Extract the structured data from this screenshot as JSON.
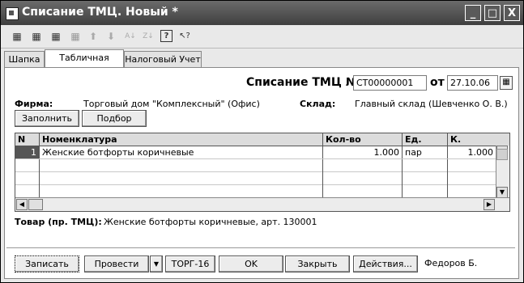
{
  "window": {
    "title": "Списание ТМЦ. Новый *"
  },
  "titlebar_buttons": {
    "minimize": "_",
    "maximize": "□",
    "close": "X"
  },
  "toolbar": {
    "icons": [
      "add-row-icon",
      "copy-row-icon",
      "delete-row-icon",
      "edit-row-icon",
      "move-up-icon",
      "move-down-icon",
      "sort-asc-icon",
      "sort-desc-icon",
      "help-icon",
      "help-pointer-icon"
    ],
    "glyphs": [
      "▦",
      "▦",
      "▦",
      "▦",
      "⬆",
      "⬇",
      "A↓",
      "Z↓",
      "?",
      "↖?"
    ]
  },
  "tabs": [
    "Шапка",
    "Табличная часть",
    "Налоговый Учет"
  ],
  "doc": {
    "heading": "Списание ТМЦ №",
    "number": "СТ00000001",
    "from_label": "от",
    "date": "27.10.06"
  },
  "firm": {
    "label": "Фирма:",
    "value": "Торговый дом \"Комплексный\" (Офис)"
  },
  "warehouse": {
    "label": "Склад:",
    "value": "Главный склад (Шевченко О. В.)"
  },
  "buttons": {
    "fill": "Заполнить",
    "select": "Подбор"
  },
  "table": {
    "columns": [
      "N",
      "Номенклатура",
      "Кол-во",
      "Ед.",
      "К."
    ],
    "rows": [
      {
        "n": "1",
        "name": "Женские ботфорты коричневые",
        "qty": "1.000",
        "unit": "пар",
        "k": "1.000"
      }
    ]
  },
  "product": {
    "label": "Товар (пр. ТМЦ):",
    "value": "Женские ботфорты коричневые, арт. 130001"
  },
  "footer": {
    "save": "Записать",
    "post": "Провести",
    "form": "ТОРГ-16",
    "ok": "OK",
    "close": "Закрыть",
    "actions": "Действия...",
    "user": "Федоров Б."
  }
}
